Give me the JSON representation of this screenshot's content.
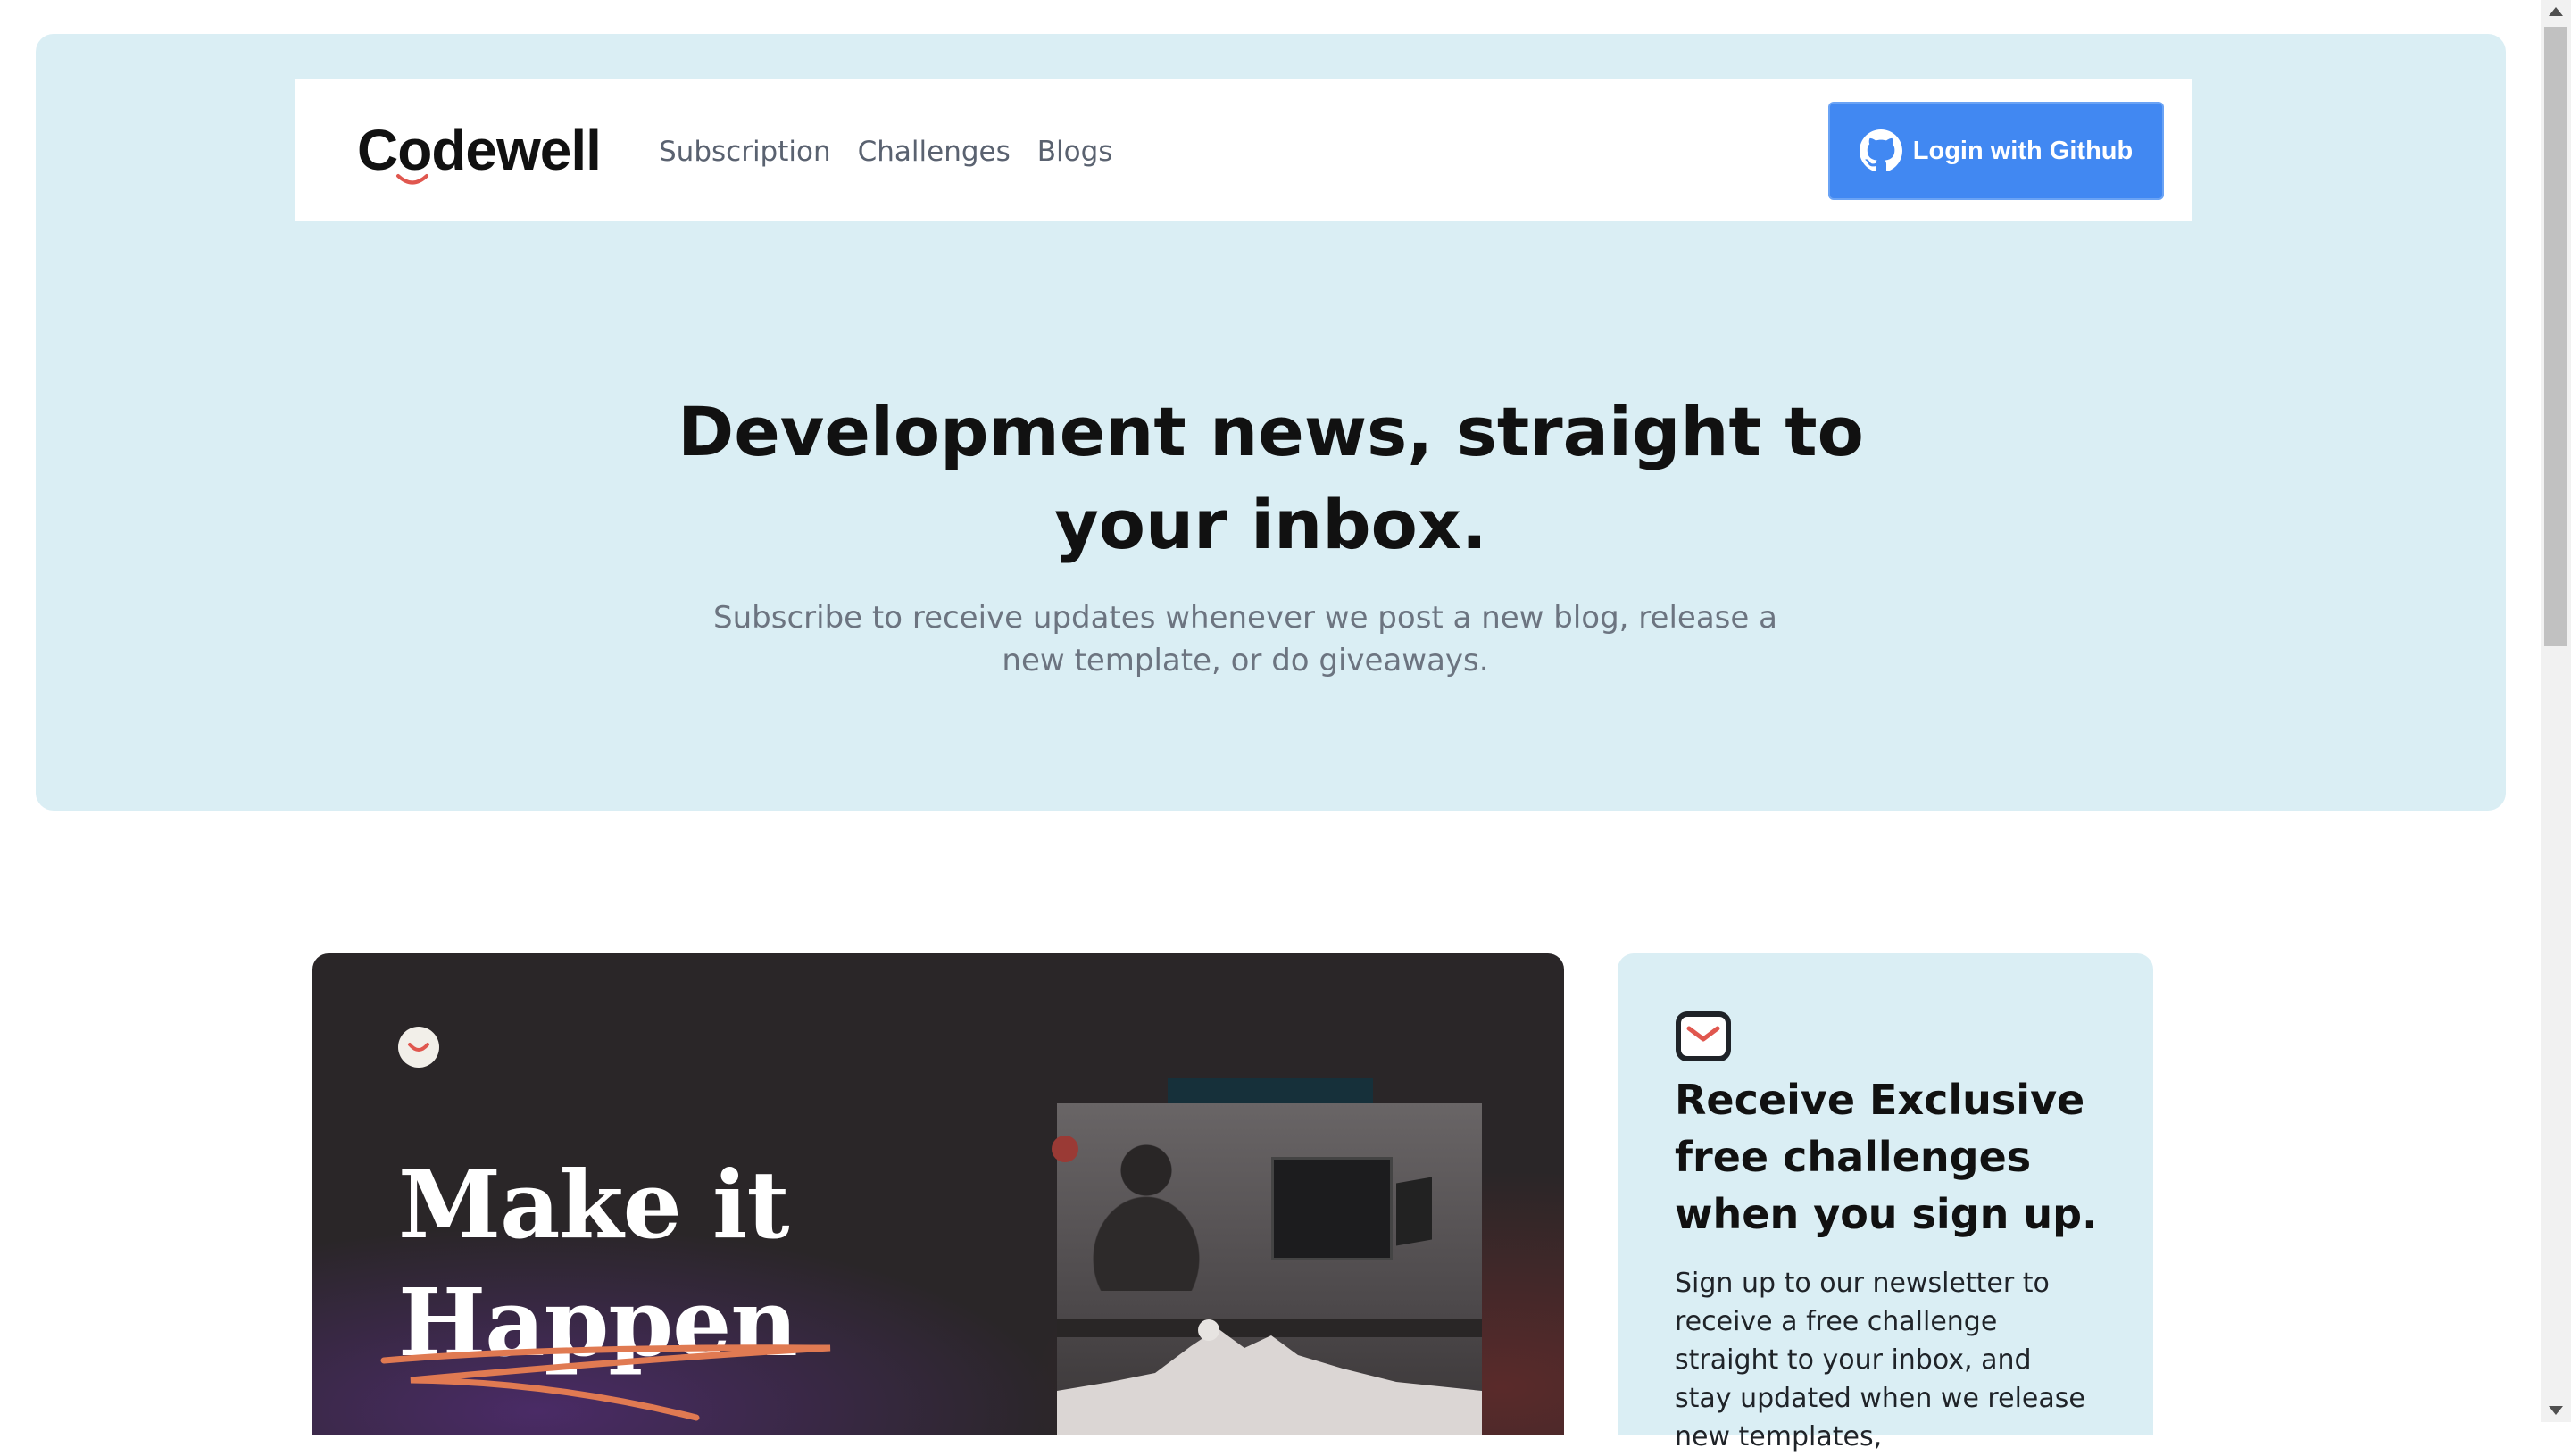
{
  "navbar": {
    "logo_text": "Codewell",
    "links": [
      {
        "label": "Subscription"
      },
      {
        "label": "Challenges"
      },
      {
        "label": "Blogs"
      }
    ],
    "login_button": {
      "label": "Login with Github",
      "icon": "github-icon"
    }
  },
  "hero": {
    "title_line1": "Development news, straight to",
    "title_line2": "your inbox.",
    "subtitle": "Subscribe to receive updates whenever we post a new blog, release a new template, or do giveaways."
  },
  "promo_image": {
    "headline_line1": "Make it",
    "headline_line2": "Happen"
  },
  "signup_card": {
    "icon": "mail-icon",
    "title": "Receive Exclusive free challenges when you sign up.",
    "text": "Sign up to our newsletter to receive a free challenge straight to your inbox, and stay updated when we release new templates,"
  },
  "colors": {
    "hero_bg": "#daeef4",
    "primary_button": "#4188f2",
    "accent": "#e0574f",
    "text_dark": "#111111",
    "text_muted": "#6c7480"
  }
}
